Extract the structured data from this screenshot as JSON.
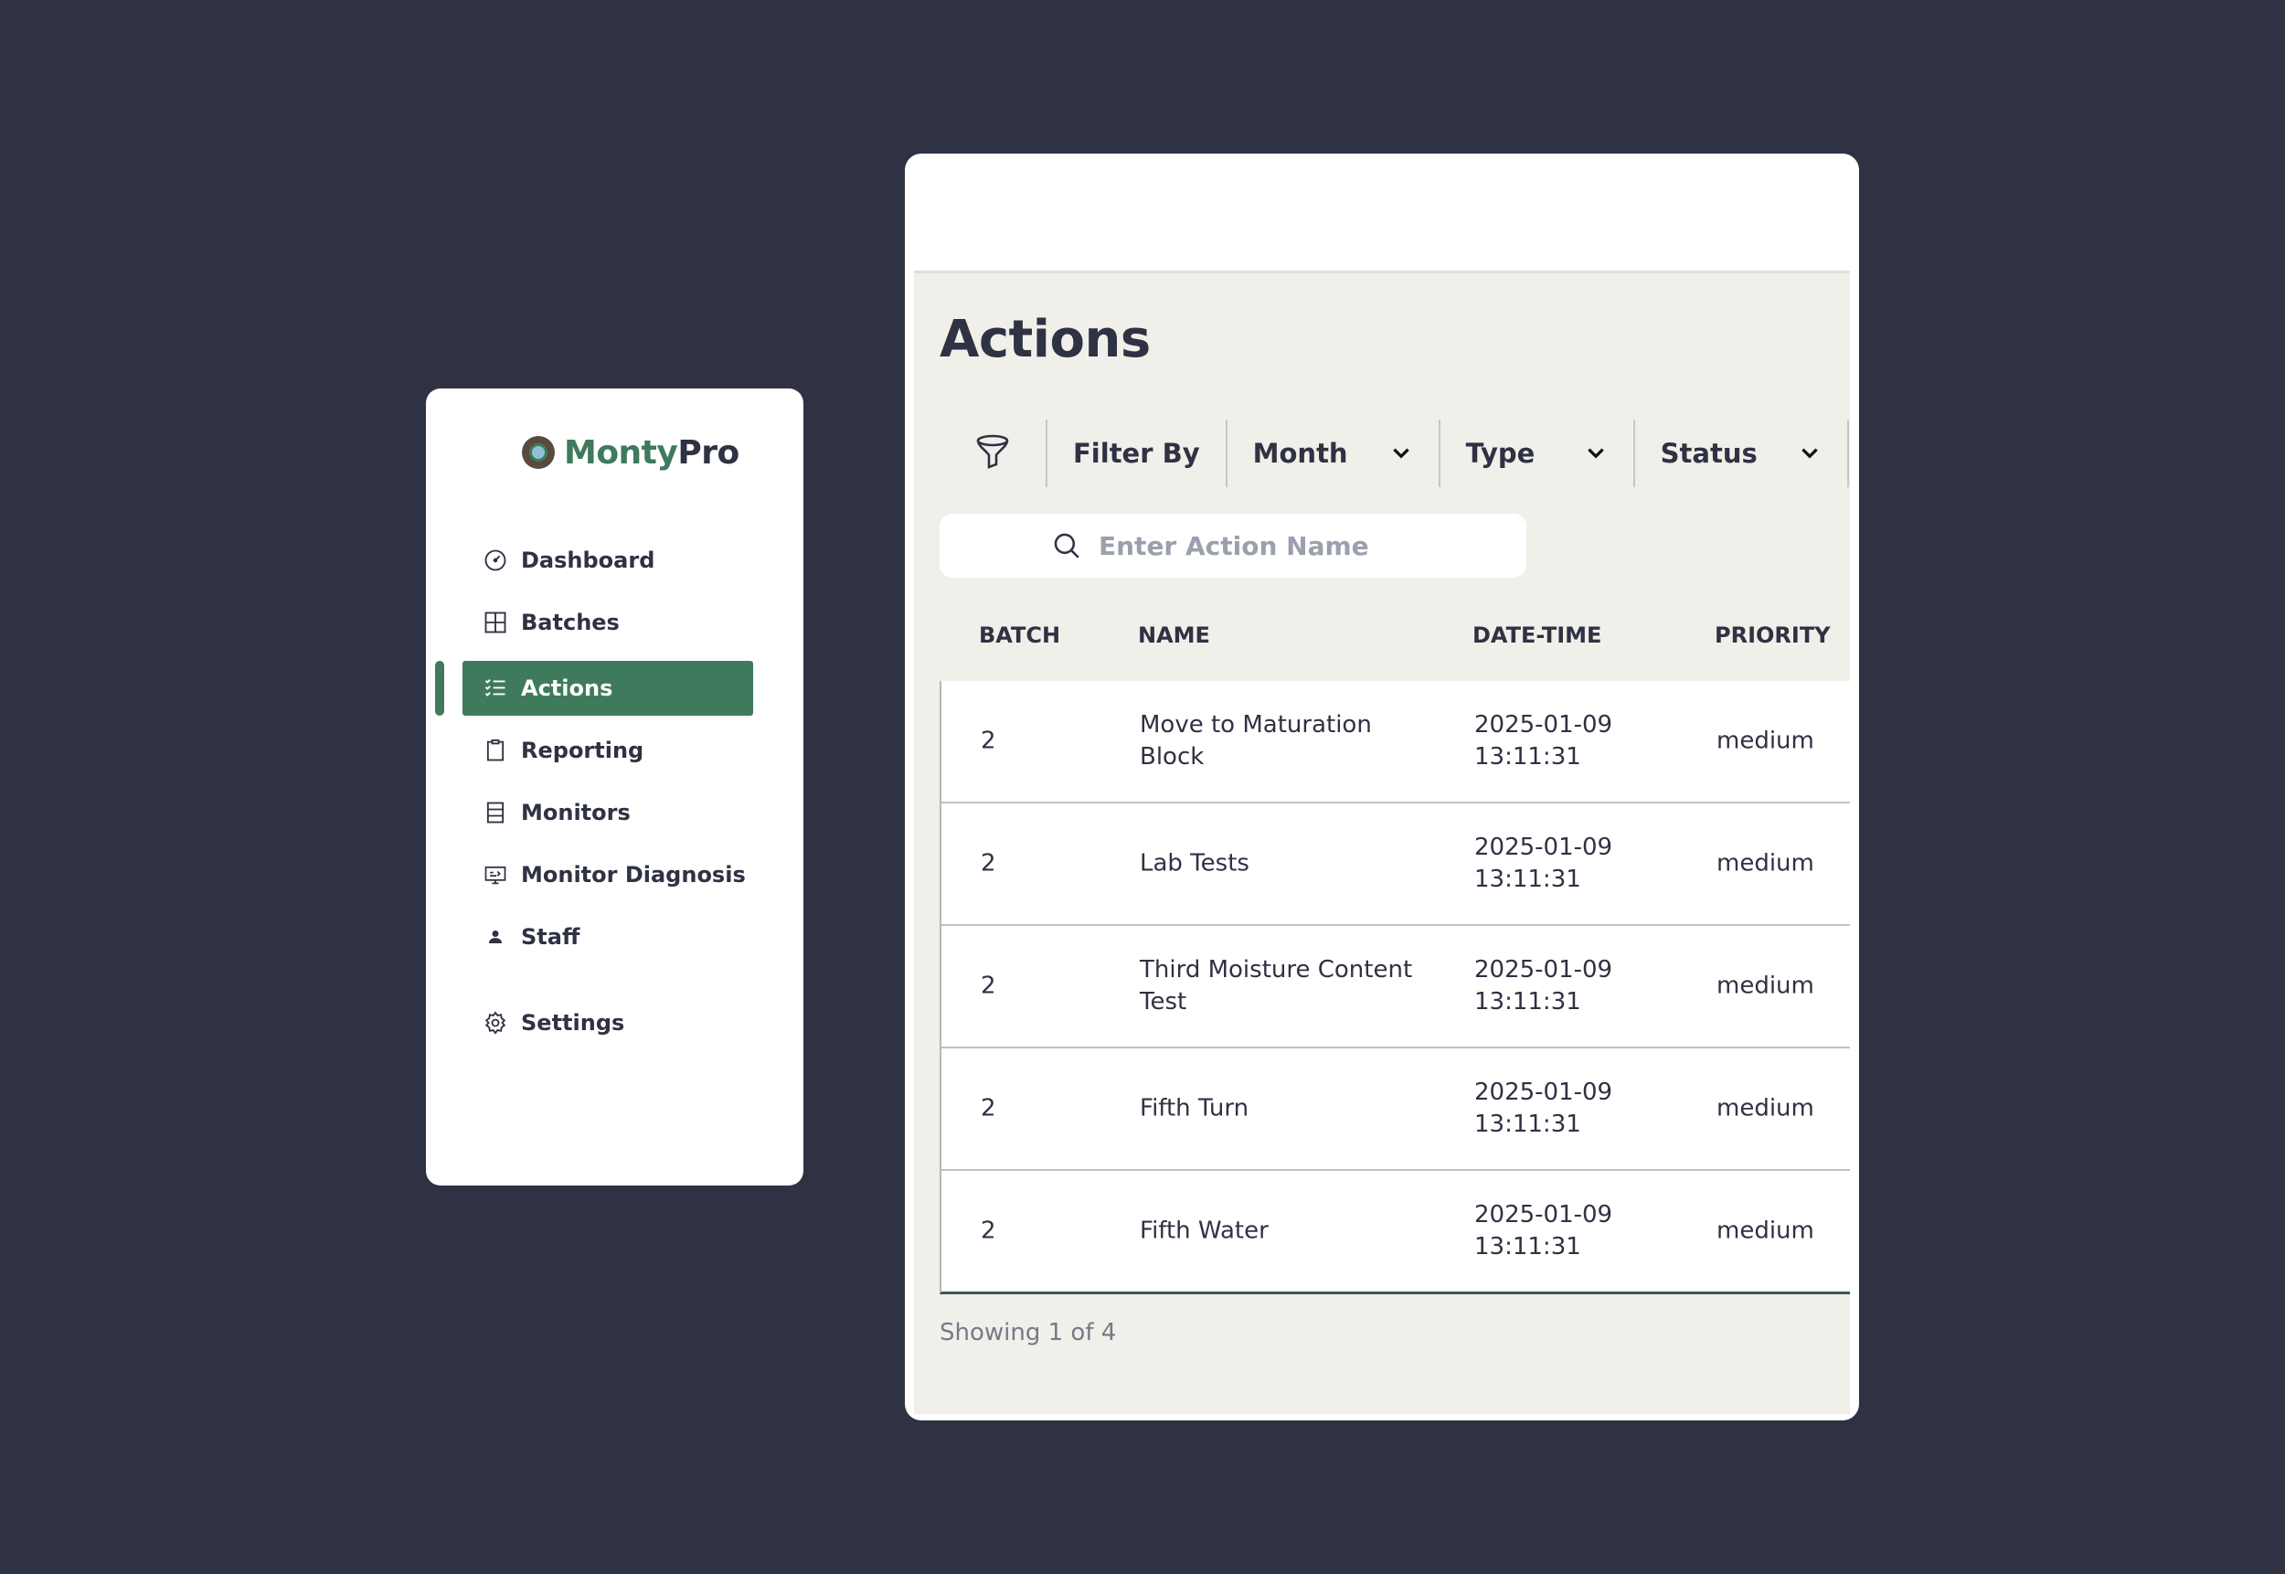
{
  "colors": {
    "background": "#2f3243",
    "accent": "#3f7a5c",
    "panel": "#ffffff",
    "content_bg": "#f1efea"
  },
  "brand": {
    "part1": "Monty",
    "part2": "Pro"
  },
  "sidebar": {
    "items": [
      {
        "label": "Dashboard",
        "icon": "dashboard-icon"
      },
      {
        "label": "Batches",
        "icon": "grid-icon"
      },
      {
        "label": "Actions",
        "icon": "checklist-icon",
        "active": true
      },
      {
        "label": "Reporting",
        "icon": "clipboard-icon"
      },
      {
        "label": "Monitors",
        "icon": "monitors-icon"
      },
      {
        "label": "Monitor Diagnosis",
        "icon": "screen-icon"
      },
      {
        "label": "Staff",
        "icon": "person-icon"
      },
      {
        "label": "Settings",
        "icon": "gear-icon"
      }
    ]
  },
  "page": {
    "title": "Actions"
  },
  "filters": {
    "filter_label": "Filter By",
    "month": "Month",
    "type": "Type",
    "status": "Status"
  },
  "search": {
    "placeholder": "Enter Action Name",
    "value": ""
  },
  "table": {
    "columns": [
      "BATCH",
      "NAME",
      "DATE-TIME",
      "PRIORITY"
    ],
    "rows": [
      {
        "batch": "2",
        "name": "Move to Maturation Block",
        "date": "2025-01-09 13:11:31",
        "priority": "medium"
      },
      {
        "batch": "2",
        "name": "Lab Tests",
        "date": "2025-01-09 13:11:31",
        "priority": "medium"
      },
      {
        "batch": "2",
        "name": "Third Moisture Content Test",
        "date": "2025-01-09 13:11:31",
        "priority": "medium"
      },
      {
        "batch": "2",
        "name": "Fifth Turn",
        "date": "2025-01-09 13:11:31",
        "priority": "medium"
      },
      {
        "batch": "2",
        "name": "Fifth Water",
        "date": "2025-01-09 13:11:31",
        "priority": "medium"
      }
    ]
  },
  "pagination": {
    "text": "Showing 1 of 4"
  }
}
